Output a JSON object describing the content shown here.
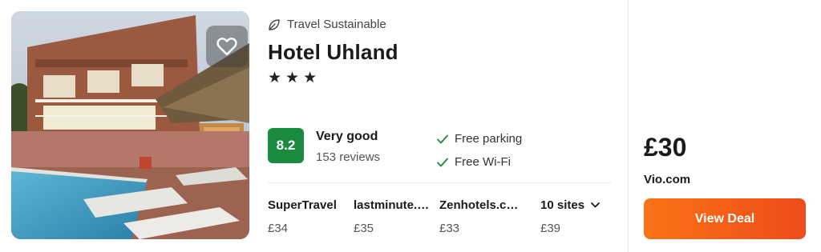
{
  "hotel": {
    "sustainability_label": "Travel Sustainable",
    "name": "Hotel Uhland",
    "stars_display": "★★★",
    "star_count": 3,
    "favorite_icon": "heart-icon"
  },
  "rating": {
    "score": "8.2",
    "label": "Very good",
    "reviews": "153 reviews",
    "color": "#1a8a3e"
  },
  "amenities": [
    {
      "icon": "check-icon",
      "label": "Free parking"
    },
    {
      "icon": "check-icon",
      "label": "Free Wi-Fi"
    }
  ],
  "sites": [
    {
      "name": "SuperTravel",
      "price": "£34"
    },
    {
      "name": "lastminute.com",
      "price": "£35"
    },
    {
      "name": "Zenhotels.com",
      "price": "£33"
    }
  ],
  "more_sites": {
    "label": "10 sites",
    "price": "£39",
    "icon": "chevron-down-icon"
  },
  "deal": {
    "price": "£30",
    "provider": "Vio.com",
    "button_label": "View Deal",
    "button_color": "#f4621f"
  }
}
